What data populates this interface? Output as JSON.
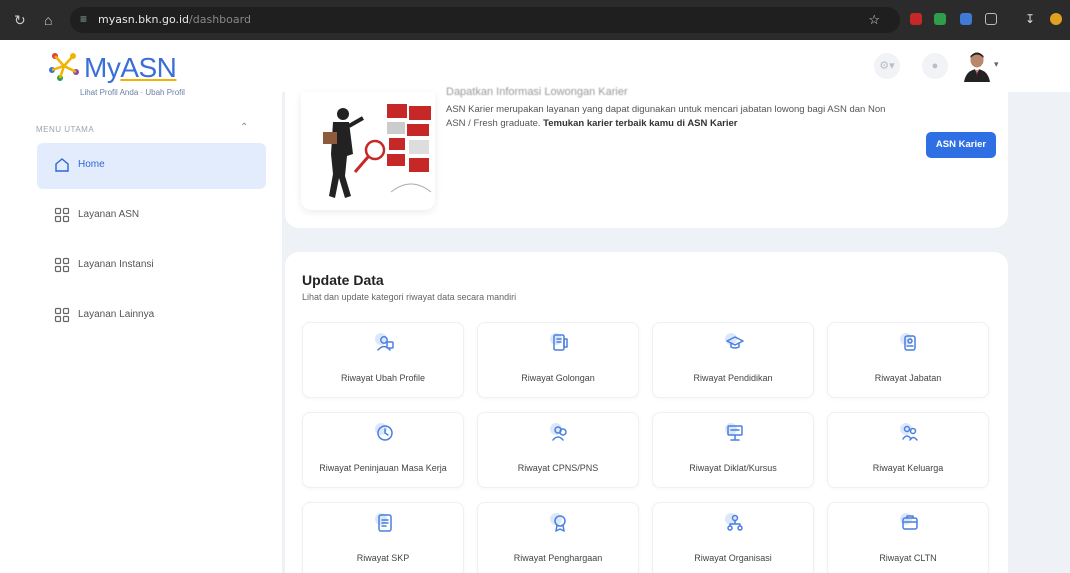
{
  "browser": {
    "url_host": "myasn.bkn.go.id",
    "url_path": "/dashboard"
  },
  "app": {
    "logo_my": "My",
    "logo_asn": "ASN"
  },
  "sidebar": {
    "profile_links": "Lihat Profil Anda · Ubah Profil",
    "section_label": "MENU UTAMA",
    "items": [
      {
        "label": "Home",
        "icon": "home-icon"
      },
      {
        "label": "Layanan ASN",
        "icon": "grid-icon"
      },
      {
        "label": "Layanan Instansi",
        "icon": "grid-icon"
      },
      {
        "label": "Layanan Lainnya",
        "icon": "grid-icon"
      }
    ]
  },
  "career": {
    "title": "Dapatkan Informasi Lowongan Karier",
    "desc_plain": "ASN Karier merupakan layanan yang dapat digunakan untuk mencari jabatan lowong bagi ASN dan Non ASN / Fresh graduate. ",
    "desc_bold": "Temukan karier terbaik kamu di ASN Karier",
    "button": "ASN Karier"
  },
  "update_data": {
    "title": "Update Data",
    "subtitle": "Lihat dan update kategori riwayat data secara mandiri",
    "tiles": [
      {
        "label": "Riwayat Ubah Profile",
        "icon": "profile-icon"
      },
      {
        "label": "Riwayat Golongan",
        "icon": "rank-icon"
      },
      {
        "label": "Riwayat Pendidikan",
        "icon": "graduation-icon"
      },
      {
        "label": "Riwayat Jabatan",
        "icon": "position-icon"
      },
      {
        "label": "Riwayat Peninjauan Masa Kerja",
        "icon": "clock-icon"
      },
      {
        "label": "Riwayat CPNS/PNS",
        "icon": "user-group-icon"
      },
      {
        "label": "Riwayat Diklat/Kursus",
        "icon": "training-icon"
      },
      {
        "label": "Riwayat Keluarga",
        "icon": "family-icon"
      },
      {
        "label": "Riwayat SKP",
        "icon": "document-icon"
      },
      {
        "label": "Riwayat Penghargaan",
        "icon": "award-icon"
      },
      {
        "label": "Riwayat Organisasi",
        "icon": "organization-icon"
      },
      {
        "label": "Riwayat CLTN",
        "icon": "leave-icon"
      }
    ]
  },
  "colors": {
    "primary": "#2f6fe4",
    "active_bg": "#e3ecfc",
    "icon_blue": "#4a7fe0"
  }
}
